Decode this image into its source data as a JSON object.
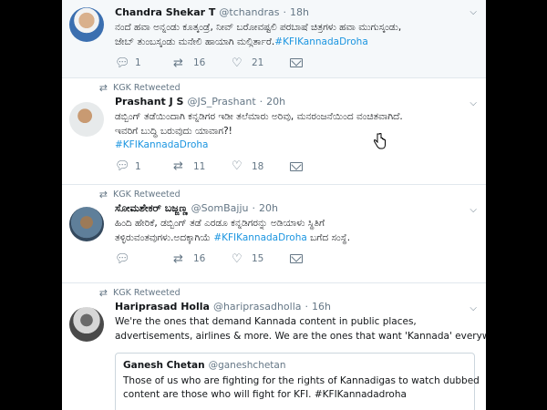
{
  "tweets": [
    {
      "name": "Chandra Shekar T",
      "handle": "@tchandras",
      "time": "18h",
      "lines": [
        "ನಂದೆ ಹವಾ ಅನ್ನಂಡು ಕೂತ್ಕಂಡ್ರೆ, ನೀವ್ ಬರೋವಷ್ಟಲಿ ಪರಬಾಷೆ ಚಿತ್ರಗಳು ಹವಾ ಮುಗುಸ್ಕಂಡು,",
        "ಜೇಬ್ ತುಂಬಸ್ಕಂಡು ಮನೇಲಿ ಹಾಯಾಗಿ ಮಲ್ಗಿರ್ತಾರೆ."
      ],
      "hashtag": "#KFIKannadaDroha",
      "replies": "1",
      "retweets": "16",
      "likes": "21"
    },
    {
      "retweeted_by": "KGK Retweeted",
      "name": "Prashant J S",
      "handle": "@JS_Prashant",
      "time": "20h",
      "lines": [
        "ಡಬ್ಬಿಂಗ್ ತಡೆಯಿಂದಾಗಿ ಕನ್ನಡಿಗರ ಇಡೀ ತಲೆಮಾರು ಅರಿವು, ಮನರಂಜನೆಯಿಂದ ವಂಚಿತವಾಗಿದೆ.",
        "ಇವರಿಗೆ ಬುದ್ಧಿ ಬರುವುದು ಯಾವಾಗ?!"
      ],
      "hashtag": "#KFIKannadaDroha",
      "replies": "1",
      "retweets": "11",
      "likes": "18"
    },
    {
      "retweeted_by": "KGK Retweeted",
      "name": "ಸೋಮಶೇಕರ್ ಬಜ್ಜಣ್ಣ",
      "handle": "@SomBajju",
      "time": "20h",
      "lines": [
        "ಹಿಂದಿ ಹೇರಿಕೆ, ಡಬ್ಬಿಂಗ್ ತಡೆ ಎರಡೂ ಕನ್ನಡಿಗರನ್ನು ಅಡಿಯಾಳು ಸ್ಥಿತಿಗೆ",
        "ತಳ್ಳಿರುವಂತವುಗಳು.ಅದಕ್ಕಾಗಿಯೆ"
      ],
      "hashtag": "#KFIKannadaDroha",
      "tail": "ಬಗೆದ ಸಂಸ್ಥೆ.",
      "replies": "",
      "retweets": "16",
      "likes": "15"
    },
    {
      "retweeted_by": "KGK Retweeted",
      "name": "Hariprasad Holla",
      "handle": "@hariprasadholla",
      "time": "16h",
      "lines": [
        "We're the ones that demand Kannada content in public places,",
        "advertisements, airlines & more. We are the ones that want 'Kannada' everywhere"
      ],
      "quote": {
        "name": "Ganesh Chetan",
        "handle": "@ganeshchetan",
        "lines": [
          "Those of us who are fighting for the rights of Kannadigas to watch dubbed",
          "content are those who will fight for KFI. #KFIKannadadroha"
        ]
      }
    }
  ],
  "icons": {
    "reply": "reply-icon",
    "retweet": "retweet-icon",
    "like": "heart-icon",
    "dm": "envelope-icon",
    "caret": "chevron-down-icon"
  },
  "colors": {
    "hashtag": "#1b95e0",
    "muted": "#657786",
    "highlight_bg": "#f5f8fa"
  }
}
